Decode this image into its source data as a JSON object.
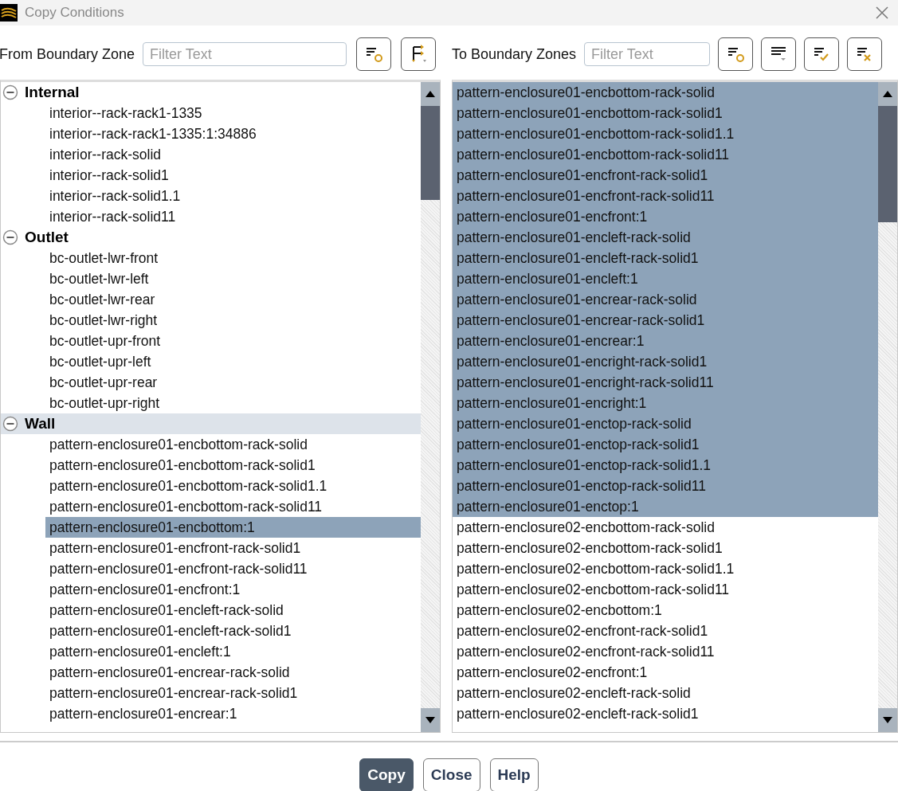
{
  "window": {
    "title": "Copy Conditions"
  },
  "from": {
    "label": "From Boundary Zone",
    "filter": {
      "placeholder": "Filter Text"
    },
    "groups": [
      {
        "label": "Internal",
        "expanded": true,
        "current": false,
        "children": [
          {
            "label": "interior--rack-rack1-1335",
            "selected": false
          },
          {
            "label": "interior--rack-rack1-1335:1:34886",
            "selected": false
          },
          {
            "label": "interior--rack-solid",
            "selected": false
          },
          {
            "label": "interior--rack-solid1",
            "selected": false
          },
          {
            "label": "interior--rack-solid1.1",
            "selected": false
          },
          {
            "label": "interior--rack-solid11",
            "selected": false
          }
        ]
      },
      {
        "label": "Outlet",
        "expanded": true,
        "current": false,
        "children": [
          {
            "label": "bc-outlet-lwr-front",
            "selected": false
          },
          {
            "label": "bc-outlet-lwr-left",
            "selected": false
          },
          {
            "label": "bc-outlet-lwr-rear",
            "selected": false
          },
          {
            "label": "bc-outlet-lwr-right",
            "selected": false
          },
          {
            "label": "bc-outlet-upr-front",
            "selected": false
          },
          {
            "label": "bc-outlet-upr-left",
            "selected": false
          },
          {
            "label": "bc-outlet-upr-rear",
            "selected": false
          },
          {
            "label": "bc-outlet-upr-right",
            "selected": false
          }
        ]
      },
      {
        "label": "Wall",
        "expanded": true,
        "current": true,
        "children": [
          {
            "label": "pattern-enclosure01-encbottom-rack-solid",
            "selected": false
          },
          {
            "label": "pattern-enclosure01-encbottom-rack-solid1",
            "selected": false
          },
          {
            "label": "pattern-enclosure01-encbottom-rack-solid1.1",
            "selected": false
          },
          {
            "label": "pattern-enclosure01-encbottom-rack-solid11",
            "selected": false
          },
          {
            "label": "pattern-enclosure01-encbottom:1",
            "selected": true
          },
          {
            "label": "pattern-enclosure01-encfront-rack-solid1",
            "selected": false
          },
          {
            "label": "pattern-enclosure01-encfront-rack-solid11",
            "selected": false
          },
          {
            "label": "pattern-enclosure01-encfront:1",
            "selected": false
          },
          {
            "label": "pattern-enclosure01-encleft-rack-solid",
            "selected": false
          },
          {
            "label": "pattern-enclosure01-encleft-rack-solid1",
            "selected": false
          },
          {
            "label": "pattern-enclosure01-encleft:1",
            "selected": false
          },
          {
            "label": "pattern-enclosure01-encrear-rack-solid",
            "selected": false
          },
          {
            "label": "pattern-enclosure01-encrear-rack-solid1",
            "selected": false
          },
          {
            "label": "pattern-enclosure01-encrear:1",
            "selected": false
          }
        ]
      }
    ]
  },
  "to": {
    "label": "To Boundary Zones",
    "filter": {
      "placeholder": "Filter Text"
    },
    "items": [
      {
        "label": "pattern-enclosure01-encbottom-rack-solid",
        "selected": true
      },
      {
        "label": "pattern-enclosure01-encbottom-rack-solid1",
        "selected": true
      },
      {
        "label": "pattern-enclosure01-encbottom-rack-solid1.1",
        "selected": true
      },
      {
        "label": "pattern-enclosure01-encbottom-rack-solid11",
        "selected": true
      },
      {
        "label": "pattern-enclosure01-encfront-rack-solid1",
        "selected": true
      },
      {
        "label": "pattern-enclosure01-encfront-rack-solid11",
        "selected": true
      },
      {
        "label": "pattern-enclosure01-encfront:1",
        "selected": true
      },
      {
        "label": "pattern-enclosure01-encleft-rack-solid",
        "selected": true
      },
      {
        "label": "pattern-enclosure01-encleft-rack-solid1",
        "selected": true
      },
      {
        "label": "pattern-enclosure01-encleft:1",
        "selected": true
      },
      {
        "label": "pattern-enclosure01-encrear-rack-solid",
        "selected": true
      },
      {
        "label": "pattern-enclosure01-encrear-rack-solid1",
        "selected": true
      },
      {
        "label": "pattern-enclosure01-encrear:1",
        "selected": true
      },
      {
        "label": "pattern-enclosure01-encright-rack-solid1",
        "selected": true
      },
      {
        "label": "pattern-enclosure01-encright-rack-solid11",
        "selected": true
      },
      {
        "label": "pattern-enclosure01-encright:1",
        "selected": true
      },
      {
        "label": "pattern-enclosure01-enctop-rack-solid",
        "selected": true
      },
      {
        "label": "pattern-enclosure01-enctop-rack-solid1",
        "selected": true
      },
      {
        "label": "pattern-enclosure01-enctop-rack-solid1.1",
        "selected": true
      },
      {
        "label": "pattern-enclosure01-enctop-rack-solid11",
        "selected": true
      },
      {
        "label": "pattern-enclosure01-enctop:1",
        "selected": true
      },
      {
        "label": "pattern-enclosure02-encbottom-rack-solid",
        "selected": false
      },
      {
        "label": "pattern-enclosure02-encbottom-rack-solid1",
        "selected": false
      },
      {
        "label": "pattern-enclosure02-encbottom-rack-solid1.1",
        "selected": false
      },
      {
        "label": "pattern-enclosure02-encbottom-rack-solid11",
        "selected": false
      },
      {
        "label": "pattern-enclosure02-encbottom:1",
        "selected": false
      },
      {
        "label": "pattern-enclosure02-encfront-rack-solid1",
        "selected": false
      },
      {
        "label": "pattern-enclosure02-encfront-rack-solid11",
        "selected": false
      },
      {
        "label": "pattern-enclosure02-encfront:1",
        "selected": false
      },
      {
        "label": "pattern-enclosure02-encleft-rack-solid",
        "selected": false
      },
      {
        "label": "pattern-enclosure02-encleft-rack-solid1",
        "selected": false
      }
    ]
  },
  "buttons": [
    {
      "label": "Copy",
      "kind": "primary"
    },
    {
      "label": "Close",
      "kind": "normal"
    },
    {
      "label": "Help",
      "kind": "normal"
    }
  ]
}
